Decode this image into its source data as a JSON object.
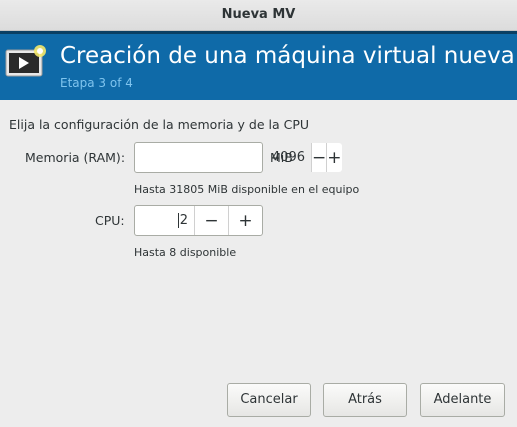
{
  "window": {
    "title": "Nueva MV"
  },
  "banner": {
    "title": "Creación de una máquina virtual nueva",
    "step": "Etapa 3 of 4",
    "icon": "vm-monitor-icon"
  },
  "intro": "Elija la configuración de la memoria y de la CPU",
  "memory": {
    "label": "Memoria (RAM):",
    "value": "4096",
    "unit": "MiB",
    "hint": "Hasta 31805 MiB disponible en el equipo",
    "decrement": "−",
    "increment": "+"
  },
  "cpu": {
    "label": "CPU:",
    "value": "2",
    "hint": "Hasta 8 disponible",
    "decrement": "−",
    "increment": "+"
  },
  "buttons": {
    "cancel": "Cancelar",
    "back": "Atrás",
    "forward": "Adelante"
  },
  "colors": {
    "banner": "#0f6aa8",
    "banner_step": "#7fc4ee",
    "background": "#ededed"
  }
}
